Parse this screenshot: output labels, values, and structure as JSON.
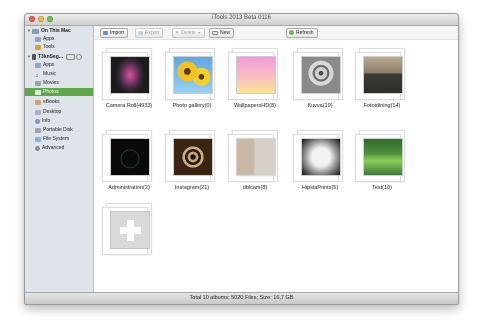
{
  "window": {
    "title": "iTools 2013 Beta 0116"
  },
  "colors": {
    "sidebar_bg": "#dfe4ea",
    "selection": "#5fa84a",
    "close": "#ee5b55",
    "minimize": "#f3bc3d",
    "zoom": "#6bc450"
  },
  "sidebar": {
    "on_this_mac": "On This Mac",
    "mac_items": [
      {
        "label": "Apps",
        "icon": "apps-icon"
      },
      {
        "label": "Tools",
        "icon": "tools-icon"
      }
    ],
    "device": "T3knSeg...",
    "device_items": [
      {
        "label": "Apps",
        "icon": "apps-icon"
      },
      {
        "label": "Music",
        "icon": "music-icon"
      },
      {
        "label": "Movies",
        "icon": "movies-icon"
      },
      {
        "label": "Photos",
        "icon": "photos-icon"
      },
      {
        "label": "eBooks",
        "icon": "ebooks-icon"
      },
      {
        "label": "Desktop",
        "icon": "desktop-icon"
      },
      {
        "label": "Info",
        "icon": "info-icon"
      },
      {
        "label": "Portable Disk",
        "icon": "disk-icon"
      },
      {
        "label": "File System",
        "icon": "folder-icon"
      },
      {
        "label": "Advanced",
        "icon": "gear-icon"
      }
    ],
    "selected": "Photos"
  },
  "toolbar": {
    "import": "Import",
    "export": "Export",
    "delete": "Delete",
    "new": "New",
    "refresh": "Refresh"
  },
  "albums": [
    {
      "label": "Camera Roll(4933)"
    },
    {
      "label": "Photo gallery(0)"
    },
    {
      "label": "WallpapersHD(8)"
    },
    {
      "label": "Kuvva(19)"
    },
    {
      "label": "Fotoidining(14)"
    },
    {
      "label": "Administration(2)"
    },
    {
      "label": "Instagram(21)"
    },
    {
      "label": "dblcam(8)"
    },
    {
      "label": "HipstaPrints(5)"
    },
    {
      "label": "Test(10)"
    }
  ],
  "add_album_icon": "plus-icon",
  "status": "Total 10 albums; 5020 Files;  Size: 16,7 GB"
}
